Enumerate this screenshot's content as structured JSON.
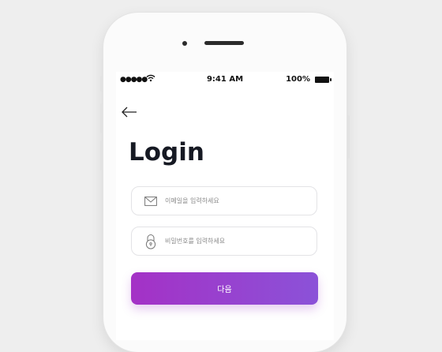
{
  "status_bar": {
    "signal": "●●●●●",
    "time": "9:41 AM",
    "battery": "100%"
  },
  "icons": {
    "back": "arrow-left-icon",
    "email": "envelope-icon",
    "password": "lock-icon",
    "wifi": "wifi-icon",
    "battery": "battery-icon"
  },
  "login": {
    "title": "Login",
    "email_placeholder": "이메일을 입력하세요",
    "password_placeholder": "비밀번호를 입력하세요",
    "next_label": "다음"
  },
  "colors": {
    "button_start": "#a431c6",
    "button_end": "#8b52d8",
    "title": "#161923",
    "background": "#eeeeee"
  }
}
